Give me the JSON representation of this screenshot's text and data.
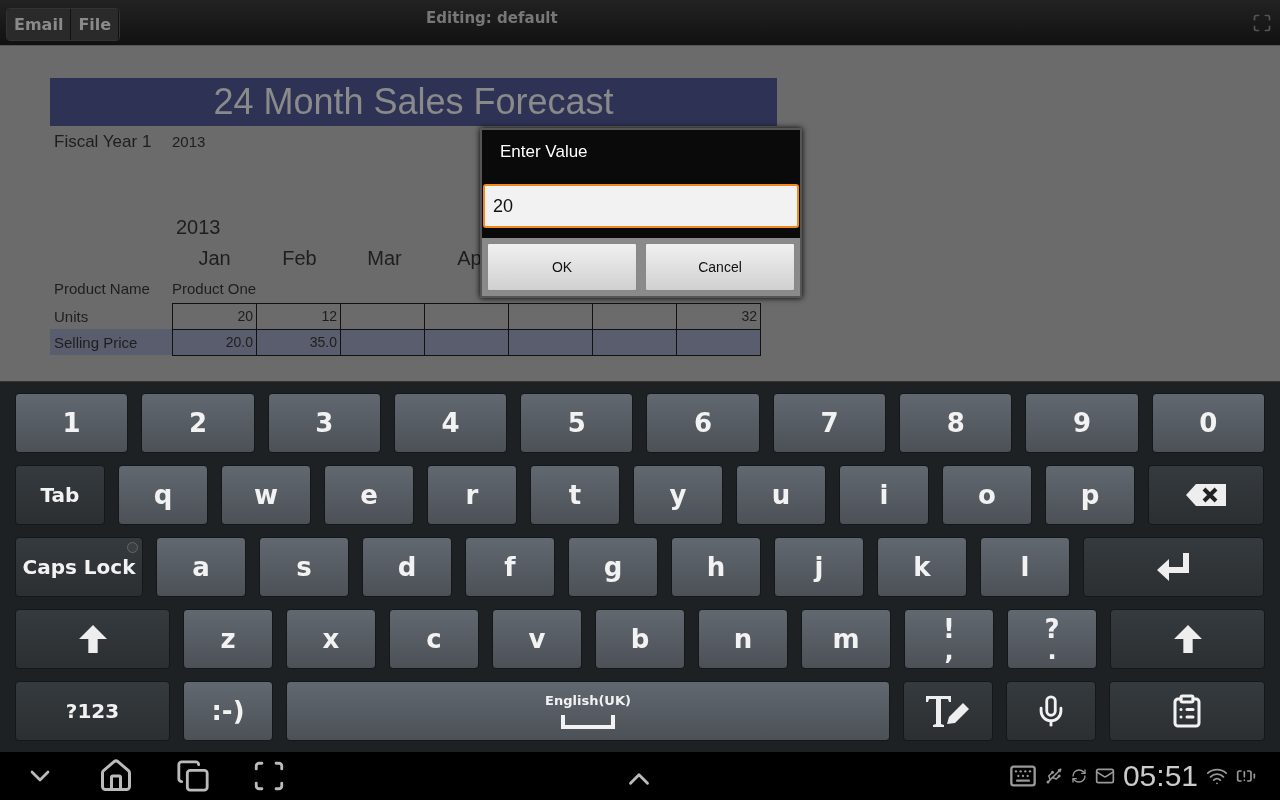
{
  "top_bar": {
    "buttons": [
      "Email",
      "File"
    ],
    "title": "Editing: default"
  },
  "sheet": {
    "title": "24 Month Sales Forecast",
    "fiscal_label": "Fiscal Year 1",
    "fiscal_value": "2013",
    "year": "2013",
    "months": [
      "Jan",
      "Feb",
      "Mar",
      "Ap"
    ],
    "product_label": "Product Name",
    "product_value": "Product One",
    "rows": [
      {
        "label": "Units",
        "selected": false,
        "cells": [
          "20",
          "12",
          null,
          null,
          null,
          null,
          "32"
        ]
      },
      {
        "label": "Selling Price",
        "selected": true,
        "cells": [
          "20.0",
          "35.0",
          null,
          null,
          null,
          null,
          null
        ]
      }
    ]
  },
  "dialog": {
    "title": "Enter Value",
    "value": "20",
    "buttons": [
      "OK",
      "Cancel"
    ]
  },
  "keyboard": {
    "rows": [
      [
        {
          "kind": "digit",
          "label": "1"
        },
        {
          "kind": "digit",
          "label": "2"
        },
        {
          "kind": "digit",
          "label": "3"
        },
        {
          "kind": "digit",
          "label": "4"
        },
        {
          "kind": "digit",
          "label": "5"
        },
        {
          "kind": "digit",
          "label": "6"
        },
        {
          "kind": "digit",
          "label": "7"
        },
        {
          "kind": "digit",
          "label": "8"
        },
        {
          "kind": "digit",
          "label": "9"
        },
        {
          "kind": "digit",
          "label": "0"
        }
      ],
      [
        {
          "kind": "tab",
          "label": "Tab"
        },
        {
          "kind": "char",
          "label": "q"
        },
        {
          "kind": "char",
          "label": "w"
        },
        {
          "kind": "char",
          "label": "e"
        },
        {
          "kind": "char",
          "label": "r"
        },
        {
          "kind": "char",
          "label": "t"
        },
        {
          "kind": "char",
          "label": "y"
        },
        {
          "kind": "char",
          "label": "u"
        },
        {
          "kind": "char",
          "label": "i"
        },
        {
          "kind": "char",
          "label": "o"
        },
        {
          "kind": "char",
          "label": "p"
        },
        {
          "kind": "backspace"
        }
      ],
      [
        {
          "kind": "caps",
          "label": "Caps Lock",
          "on": false
        },
        {
          "kind": "char",
          "label": "a"
        },
        {
          "kind": "char",
          "label": "s"
        },
        {
          "kind": "char",
          "label": "d"
        },
        {
          "kind": "char",
          "label": "f"
        },
        {
          "kind": "char",
          "label": "g"
        },
        {
          "kind": "char",
          "label": "h"
        },
        {
          "kind": "char",
          "label": "j"
        },
        {
          "kind": "char",
          "label": "k"
        },
        {
          "kind": "char",
          "label": "l"
        },
        {
          "kind": "enter"
        }
      ],
      [
        {
          "kind": "shift"
        },
        {
          "kind": "char",
          "label": "z"
        },
        {
          "kind": "char",
          "label": "x"
        },
        {
          "kind": "char",
          "label": "c"
        },
        {
          "kind": "char",
          "label": "v"
        },
        {
          "kind": "char",
          "label": "b"
        },
        {
          "kind": "char",
          "label": "n"
        },
        {
          "kind": "char",
          "label": "m"
        },
        {
          "kind": "char",
          "label": "!",
          "sub": ","
        },
        {
          "kind": "char",
          "label": "?",
          "sub": "."
        },
        {
          "kind": "shift"
        }
      ],
      [
        {
          "kind": "symbols",
          "label": "?123"
        },
        {
          "kind": "char",
          "label": ":-)"
        },
        {
          "kind": "space",
          "label": "English(UK)"
        },
        {
          "kind": "handwriting"
        },
        {
          "kind": "mic"
        },
        {
          "kind": "clipboard"
        }
      ]
    ]
  },
  "status_bar": {
    "time": "05:51"
  }
}
